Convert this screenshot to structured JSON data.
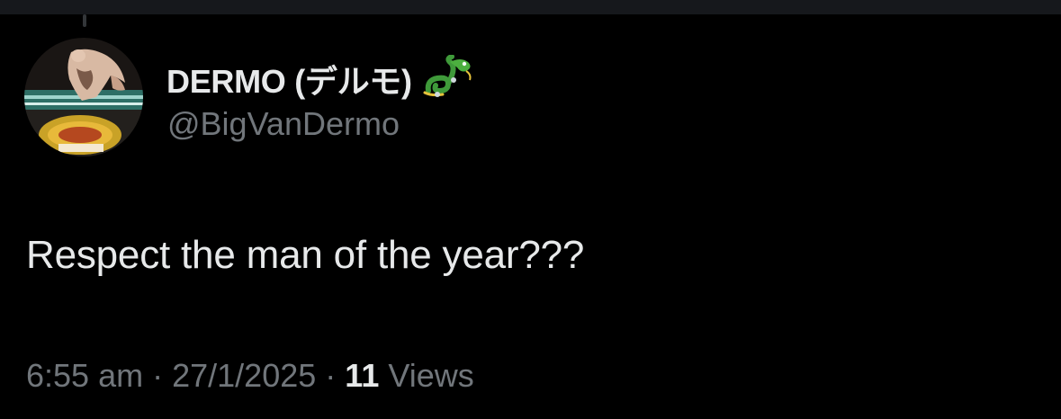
{
  "author": {
    "display_name": "DERMO (デルモ)",
    "name_emoji": "dragon-emoji",
    "handle": "@BigVanDermo",
    "avatar": "wrestler-avatar-image"
  },
  "tweet": {
    "text": "Respect the man of the year???"
  },
  "meta": {
    "time": "6:55 am",
    "separator": "·",
    "date": "27/1/2025",
    "views_count": "11",
    "views_label": "Views"
  },
  "colors": {
    "background": "#000000",
    "primary_text": "#e7e9ea",
    "secondary_text": "#71767b",
    "top_bar": "#16181c"
  }
}
